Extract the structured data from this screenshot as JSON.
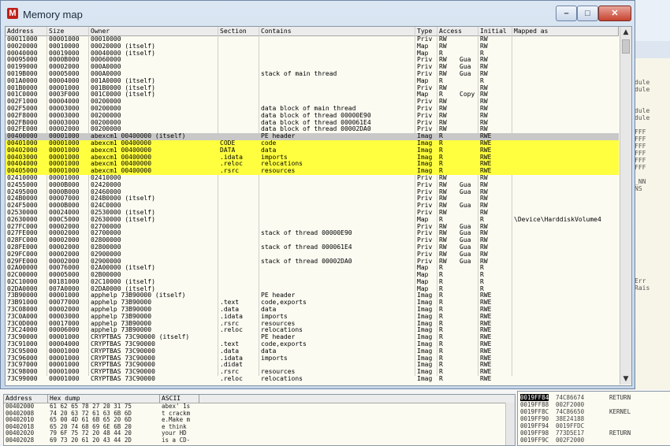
{
  "window": {
    "title": "Memory map",
    "app_icon": "M",
    "minimize_glyph": "–",
    "maximize_glyph": "□",
    "close_glyph": "✕"
  },
  "columns": [
    "Address",
    "Size",
    "Owner",
    "Section",
    "Contains",
    "Type",
    "Access",
    "Initial",
    "Mapped as"
  ],
  "rows": [
    [
      "00011000",
      "00001000",
      "",
      "00010000",
      "",
      "",
      "Priv",
      "RW",
      "",
      "RW",
      ""
    ],
    [
      "00020000",
      "00010000",
      "",
      "00020000 (itself)",
      "",
      "",
      "Map",
      "RW",
      "",
      "RW",
      ""
    ],
    [
      "00040000",
      "00019000",
      "",
      "00040000 (itself)",
      "",
      "",
      "Map",
      "R",
      "",
      "R",
      ""
    ],
    [
      "00095000",
      "0000B000",
      "",
      "00060000",
      "",
      "",
      "Priv",
      "RW",
      "Gua",
      "RW",
      ""
    ],
    [
      "00199000",
      "00002000",
      "",
      "000A0000",
      "",
      "",
      "Priv",
      "RW",
      "Gua",
      "RW",
      ""
    ],
    [
      "0019B000",
      "00005000",
      "",
      "000A0000",
      "",
      "stack of main thread",
      "Priv",
      "RW",
      "Gua",
      "RW",
      ""
    ],
    [
      "001A0000",
      "00004000",
      "",
      "001A0000 (itself)",
      "",
      "",
      "Map",
      "R",
      "",
      "R",
      ""
    ],
    [
      "001B0000",
      "00001000",
      "",
      "001B0000 (itself)",
      "",
      "",
      "Priv",
      "RW",
      "",
      "RW",
      ""
    ],
    [
      "001C0000",
      "0003F000",
      "",
      "001C0000 (itself)",
      "",
      "",
      "Map",
      "R",
      "Copy",
      "RW",
      ""
    ],
    [
      "002F1000",
      "00004000",
      "",
      "00200000",
      "",
      "",
      "Priv",
      "RW",
      "",
      "RW",
      ""
    ],
    [
      "002F5000",
      "00003000",
      "",
      "00200000",
      "",
      "data block of main thread",
      "Priv",
      "RW",
      "",
      "RW",
      ""
    ],
    [
      "002F8000",
      "00003000",
      "",
      "00200000",
      "",
      "data block of thread 00000E90",
      "Priv",
      "RW",
      "",
      "RW",
      ""
    ],
    [
      "002FB000",
      "00003000",
      "",
      "00200000",
      "",
      "data block of thread 000061E4",
      "Priv",
      "RW",
      "",
      "RW",
      ""
    ],
    [
      "002FE000",
      "00002000",
      "",
      "00200000",
      "",
      "data block of thread 00002DA0",
      "Priv",
      "RW",
      "",
      "RW",
      ""
    ],
    [
      "00400000",
      "00001000",
      "abexcm1",
      "00400000 (itself)",
      "",
      "PE header",
      "Imag",
      "R",
      "",
      "RWE",
      ""
    ],
    [
      "00401000",
      "00001000",
      "abexcm1",
      "00400000",
      "CODE",
      "code",
      "Imag",
      "R",
      "",
      "RWE",
      ""
    ],
    [
      "00402000",
      "00001000",
      "abexcm1",
      "00400000",
      "DATA",
      "data",
      "Imag",
      "R",
      "",
      "RWE",
      ""
    ],
    [
      "00403000",
      "00001000",
      "abexcm1",
      "00400000",
      ".idata",
      "imports",
      "Imag",
      "R",
      "",
      "RWE",
      ""
    ],
    [
      "00404000",
      "00001000",
      "abexcm1",
      "00400000",
      ".reloc",
      "relocations",
      "Imag",
      "R",
      "",
      "RWE",
      ""
    ],
    [
      "00405000",
      "00001000",
      "abexcm1",
      "00400000",
      ".rsrc",
      "resources",
      "Imag",
      "R",
      "",
      "RWE",
      ""
    ],
    [
      "02410000",
      "00001000",
      "",
      "02410000",
      "",
      "",
      "Priv",
      "RW",
      "",
      "RW",
      ""
    ],
    [
      "02455000",
      "0000B000",
      "",
      "02420000",
      "",
      "",
      "Priv",
      "RW",
      "Gua",
      "RW",
      ""
    ],
    [
      "02495000",
      "0000B000",
      "",
      "02460000",
      "",
      "",
      "Priv",
      "RW",
      "Gua",
      "RW",
      ""
    ],
    [
      "024B0000",
      "00007000",
      "",
      "024B0000 (itself)",
      "",
      "",
      "Priv",
      "RW",
      "",
      "RW",
      ""
    ],
    [
      "024F5000",
      "0000B000",
      "",
      "024C0000",
      "",
      "",
      "Priv",
      "RW",
      "Gua",
      "RW",
      ""
    ],
    [
      "02530000",
      "00024000",
      "",
      "02530000 (itself)",
      "",
      "",
      "Priv",
      "RW",
      "",
      "RW",
      ""
    ],
    [
      "02630000",
      "000C5000",
      "",
      "02630000 (itself)",
      "",
      "",
      "Map",
      "R",
      "",
      "R",
      "\\Device\\HarddiskVolume4"
    ],
    [
      "027FC000",
      "00002000",
      "",
      "02700000",
      "",
      "",
      "Priv",
      "RW",
      "Gua",
      "RW",
      ""
    ],
    [
      "027FE000",
      "00002000",
      "",
      "02700000",
      "",
      "stack of thread 00000E90",
      "Priv",
      "RW",
      "Gua",
      "RW",
      ""
    ],
    [
      "028FC000",
      "00002000",
      "",
      "02800000",
      "",
      "",
      "Priv",
      "RW",
      "Gua",
      "RW",
      ""
    ],
    [
      "028FE000",
      "00002000",
      "",
      "02800000",
      "",
      "stack of thread 000061E4",
      "Priv",
      "RW",
      "Gua",
      "RW",
      ""
    ],
    [
      "029FC000",
      "00002000",
      "",
      "02900000",
      "",
      "",
      "Priv",
      "RW",
      "Gua",
      "RW",
      ""
    ],
    [
      "029FE000",
      "00002000",
      "",
      "02900000",
      "",
      "stack of thread 00002DA0",
      "Priv",
      "RW",
      "Gua",
      "RW",
      ""
    ],
    [
      "02A00000",
      "00076000",
      "",
      "02A00000 (itself)",
      "",
      "",
      "Map",
      "R",
      "",
      "R",
      ""
    ],
    [
      "02C00000",
      "00005000",
      "",
      "02B00000",
      "",
      "",
      "Map",
      "R",
      "",
      "R",
      ""
    ],
    [
      "02C10000",
      "00181000",
      "",
      "02C10000 (itself)",
      "",
      "",
      "Map",
      "R",
      "",
      "R",
      ""
    ],
    [
      "02DA0000",
      "007A0000",
      "",
      "02DA0000 (itself)",
      "",
      "",
      "Map",
      "R",
      "",
      "R",
      ""
    ],
    [
      "73B90000",
      "00001000",
      "apphelp",
      "73B90000 (itself)",
      "",
      "PE header",
      "Imag",
      "R",
      "",
      "RWE",
      ""
    ],
    [
      "73B91000",
      "00077000",
      "apphelp",
      "73B90000",
      ".text",
      "code,exports",
      "Imag",
      "R",
      "",
      "RWE",
      ""
    ],
    [
      "73C08000",
      "00002000",
      "apphelp",
      "73B90000",
      ".data",
      "data",
      "Imag",
      "R",
      "",
      "RWE",
      ""
    ],
    [
      "73C0A000",
      "00003000",
      "apphelp",
      "73B90000",
      ".idata",
      "imports",
      "Imag",
      "R",
      "",
      "RWE",
      ""
    ],
    [
      "73C0D000",
      "00017000",
      "apphelp",
      "73B90000",
      ".rsrc",
      "resources",
      "Imag",
      "R",
      "",
      "RWE",
      ""
    ],
    [
      "73C24000",
      "00006000",
      "apphelp",
      "73B90000",
      ".reloc",
      "relocations",
      "Imag",
      "R",
      "",
      "RWE",
      ""
    ],
    [
      "73C90000",
      "00001000",
      "CRYPTBAS",
      "73C90000 (itself)",
      "",
      "PE header",
      "Imag",
      "R",
      "",
      "RWE",
      ""
    ],
    [
      "73C91000",
      "00004000",
      "CRYPTBAS",
      "73C90000",
      ".text",
      "code,exports",
      "Imag",
      "R",
      "",
      "RWE",
      ""
    ],
    [
      "73C95000",
      "00001000",
      "CRYPTBAS",
      "73C90000",
      ".data",
      "data",
      "Imag",
      "R",
      "",
      "RWE",
      ""
    ],
    [
      "73C96000",
      "00001000",
      "CRYPTBAS",
      "73C90000",
      ".idata",
      "imports",
      "Imag",
      "R",
      "",
      "RWE",
      ""
    ],
    [
      "73C97000",
      "00001000",
      "CRYPTBAS",
      "73C90000",
      ".didat",
      "",
      "Imag",
      "R",
      "",
      "RWE",
      ""
    ],
    [
      "73C98000",
      "00001000",
      "CRYPTBAS",
      "73C90000",
      ".rsrc",
      "resources",
      "Imag",
      "R",
      "",
      "RWE",
      ""
    ],
    [
      "73C99000",
      "00001000",
      "CRYPTBAS",
      "73C90000",
      ".reloc",
      "relocations",
      "Imag",
      "R",
      "",
      "RWE",
      ""
    ]
  ],
  "selected_row_index": 14,
  "highlighted_rows": [
    14,
    15,
    16,
    17,
    18,
    19
  ],
  "highlight_color": "#ffff40",
  "dump": {
    "columns": [
      "Address",
      "Hex dump",
      "ASCII"
    ],
    "rows": [
      [
        "00402000",
        "61 62 65 78 27 20 31 75",
        "abex' 1s"
      ],
      [
        "00402008",
        "74 20 63 72 61 63 6B 6D",
        "t crackm"
      ],
      [
        "00402010",
        "65 00 4D 61 6B 65 20 6D",
        "e.Make m"
      ],
      [
        "00402018",
        "65 20 74 68 69 6E 6B 20",
        "e think "
      ],
      [
        "00402020",
        "79 6F 75 72 20 48 44 20",
        "your HD "
      ],
      [
        "00402028",
        "69 73 20 61 20 43 44 2D",
        "is a CD-"
      ]
    ]
  },
  "stack": {
    "rows": [
      [
        "0019FF84",
        "74C86674",
        "RETURN"
      ],
      [
        "0019FF88",
        "002F2000",
        ""
      ],
      [
        "0019FF8C",
        "74C86650",
        "KERNEL"
      ],
      [
        "0019FF90",
        "38E24188",
        ""
      ],
      [
        "0019FF94",
        "0019FFDC",
        ""
      ],
      [
        "0019FF98",
        "773D5E17",
        "RETURN"
      ],
      [
        "0019FF9C",
        "002F2000",
        ""
      ]
    ]
  },
  "background_window": {
    "lines": [
      "dule",
      "dule",
      "",
      "",
      "dule",
      "dule",
      "",
      "FFF",
      "FFF",
      "FFF",
      "FFF",
      "FFF",
      "FFF",
      "",
      "_NN",
      "NS",
      "",
      "",
      "",
      "",
      "",
      "",
      "",
      "",
      "",
      "",
      "",
      "",
      "Err",
      "Rais"
    ]
  },
  "scroll": {
    "up_arrow": "▲",
    "down_arrow": "▼"
  }
}
